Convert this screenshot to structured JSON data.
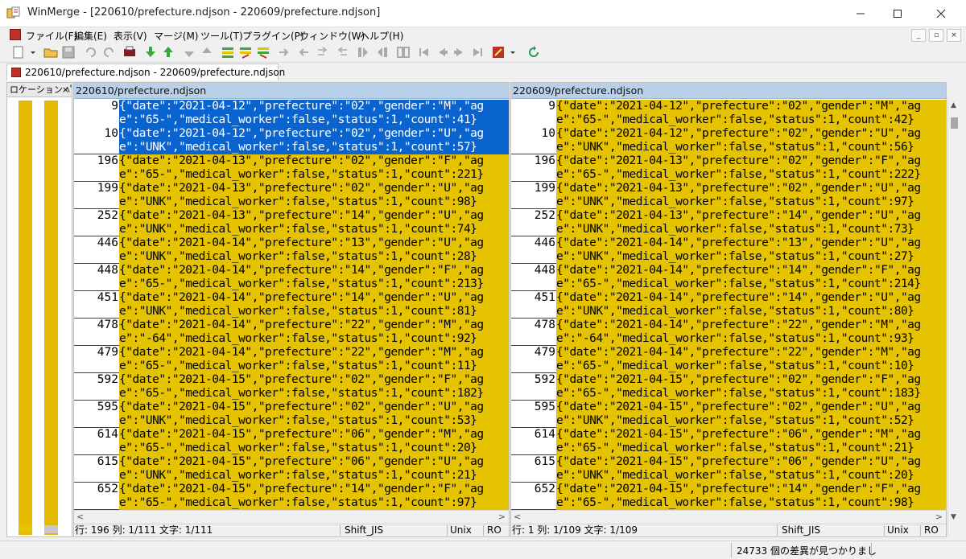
{
  "window": {
    "title": "WinMerge - [220610/prefecture.ndjson - 220609/prefecture.ndjson]"
  },
  "menu": [
    "ファイル(F)",
    "編集(E)",
    "表示(V)",
    "マージ(M)",
    "ツール(T)",
    "プラグイン(P)",
    "ウィンドウ(W)",
    "ヘルプ(H)"
  ],
  "tab": {
    "label": "220610/prefecture.ndjson - 220609/prefecture.ndjson"
  },
  "location_pane": {
    "title": "ロケーション ﾍﾟｲﾝ",
    "close": "×"
  },
  "left": {
    "path": "220610/prefecture.ndjson",
    "rows": [
      {
        "num": "9",
        "a": "{\"date\":\"2021-04-12\",\"prefecture\":\"02\",\"gender\":\"M\",\"ag",
        "b": "e\":\"65-\",\"medical_worker\":false,\"status\":1,\"count\":41}"
      },
      {
        "num": "10",
        "a": "{\"date\":\"2021-04-12\",\"prefecture\":\"02\",\"gender\":\"U\",\"ag",
        "b": "e\":\"UNK\",\"medical_worker\":false,\"status\":1,\"count\":57}"
      },
      {
        "num": "196",
        "a": "{\"date\":\"2021-04-13\",\"prefecture\":\"02\",\"gender\":\"F\",\"ag",
        "b": "e\":\"65-\",\"medical_worker\":false,\"status\":1,\"count\":221}"
      },
      {
        "num": "199",
        "a": "{\"date\":\"2021-04-13\",\"prefecture\":\"02\",\"gender\":\"U\",\"ag",
        "b": "e\":\"UNK\",\"medical_worker\":false,\"status\":1,\"count\":98}"
      },
      {
        "num": "252",
        "a": "{\"date\":\"2021-04-13\",\"prefecture\":\"14\",\"gender\":\"U\",\"ag",
        "b": "e\":\"UNK\",\"medical_worker\":false,\"status\":1,\"count\":74}"
      },
      {
        "num": "446",
        "a": "{\"date\":\"2021-04-14\",\"prefecture\":\"13\",\"gender\":\"U\",\"ag",
        "b": "e\":\"UNK\",\"medical_worker\":false,\"status\":1,\"count\":28}"
      },
      {
        "num": "448",
        "a": "{\"date\":\"2021-04-14\",\"prefecture\":\"14\",\"gender\":\"F\",\"ag",
        "b": "e\":\"65-\",\"medical_worker\":false,\"status\":1,\"count\":213}"
      },
      {
        "num": "451",
        "a": "{\"date\":\"2021-04-14\",\"prefecture\":\"14\",\"gender\":\"U\",\"ag",
        "b": "e\":\"UNK\",\"medical_worker\":false,\"status\":1,\"count\":81}"
      },
      {
        "num": "478",
        "a": "{\"date\":\"2021-04-14\",\"prefecture\":\"22\",\"gender\":\"M\",\"ag",
        "b": "e\":\"-64\",\"medical_worker\":false,\"status\":1,\"count\":92}"
      },
      {
        "num": "479",
        "a": "{\"date\":\"2021-04-14\",\"prefecture\":\"22\",\"gender\":\"M\",\"ag",
        "b": "e\":\"65-\",\"medical_worker\":false,\"status\":1,\"count\":11}"
      },
      {
        "num": "592",
        "a": "{\"date\":\"2021-04-15\",\"prefecture\":\"02\",\"gender\":\"F\",\"ag",
        "b": "e\":\"65-\",\"medical_worker\":false,\"status\":1,\"count\":182}"
      },
      {
        "num": "595",
        "a": "{\"date\":\"2021-04-15\",\"prefecture\":\"02\",\"gender\":\"U\",\"ag",
        "b": "e\":\"UNK\",\"medical_worker\":false,\"status\":1,\"count\":53}"
      },
      {
        "num": "614",
        "a": "{\"date\":\"2021-04-15\",\"prefecture\":\"06\",\"gender\":\"M\",\"ag",
        "b": "e\":\"65-\",\"medical_worker\":false,\"status\":1,\"count\":20}"
      },
      {
        "num": "615",
        "a": "{\"date\":\"2021-04-15\",\"prefecture\":\"06\",\"gender\":\"U\",\"ag",
        "b": "e\":\"UNK\",\"medical_worker\":false,\"status\":1,\"count\":21}"
      },
      {
        "num": "652",
        "a": "{\"date\":\"2021-04-15\",\"prefecture\":\"14\",\"gender\":\"F\",\"ag",
        "b": "e\":\"65-\",\"medical_worker\":false,\"status\":1,\"count\":97}"
      }
    ],
    "status": {
      "pos": "行: 196  列: 1/111  文字: 1/111",
      "encoding": "Shift_JIS",
      "eol": "Unix",
      "ro": "RO"
    }
  },
  "right": {
    "path": "220609/prefecture.ndjson",
    "rows": [
      {
        "num": "9",
        "a": "{\"date\":\"2021-04-12\",\"prefecture\":\"02\",\"gender\":\"M\",\"ag",
        "b": "e\":\"65-\",\"medical_worker\":false,\"status\":1,\"count\":42}"
      },
      {
        "num": "10",
        "a": "{\"date\":\"2021-04-12\",\"prefecture\":\"02\",\"gender\":\"U\",\"ag",
        "b": "e\":\"UNK\",\"medical_worker\":false,\"status\":1,\"count\":56}"
      },
      {
        "num": "196",
        "a": "{\"date\":\"2021-04-13\",\"prefecture\":\"02\",\"gender\":\"F\",\"ag",
        "b": "e\":\"65-\",\"medical_worker\":false,\"status\":1,\"count\":222}"
      },
      {
        "num": "199",
        "a": "{\"date\":\"2021-04-13\",\"prefecture\":\"02\",\"gender\":\"U\",\"ag",
        "b": "e\":\"UNK\",\"medical_worker\":false,\"status\":1,\"count\":97}"
      },
      {
        "num": "252",
        "a": "{\"date\":\"2021-04-13\",\"prefecture\":\"14\",\"gender\":\"U\",\"ag",
        "b": "e\":\"UNK\",\"medical_worker\":false,\"status\":1,\"count\":73}"
      },
      {
        "num": "446",
        "a": "{\"date\":\"2021-04-14\",\"prefecture\":\"13\",\"gender\":\"U\",\"ag",
        "b": "e\":\"UNK\",\"medical_worker\":false,\"status\":1,\"count\":27}"
      },
      {
        "num": "448",
        "a": "{\"date\":\"2021-04-14\",\"prefecture\":\"14\",\"gender\":\"F\",\"ag",
        "b": "e\":\"65-\",\"medical_worker\":false,\"status\":1,\"count\":214}"
      },
      {
        "num": "451",
        "a": "{\"date\":\"2021-04-14\",\"prefecture\":\"14\",\"gender\":\"U\",\"ag",
        "b": "e\":\"UNK\",\"medical_worker\":false,\"status\":1,\"count\":80}"
      },
      {
        "num": "478",
        "a": "{\"date\":\"2021-04-14\",\"prefecture\":\"22\",\"gender\":\"M\",\"ag",
        "b": "e\":\"-64\",\"medical_worker\":false,\"status\":1,\"count\":93}"
      },
      {
        "num": "479",
        "a": "{\"date\":\"2021-04-14\",\"prefecture\":\"22\",\"gender\":\"M\",\"ag",
        "b": "e\":\"65-\",\"medical_worker\":false,\"status\":1,\"count\":10}"
      },
      {
        "num": "592",
        "a": "{\"date\":\"2021-04-15\",\"prefecture\":\"02\",\"gender\":\"F\",\"ag",
        "b": "e\":\"65-\",\"medical_worker\":false,\"status\":1,\"count\":183}"
      },
      {
        "num": "595",
        "a": "{\"date\":\"2021-04-15\",\"prefecture\":\"02\",\"gender\":\"U\",\"ag",
        "b": "e\":\"UNK\",\"medical_worker\":false,\"status\":1,\"count\":52}"
      },
      {
        "num": "614",
        "a": "{\"date\":\"2021-04-15\",\"prefecture\":\"06\",\"gender\":\"M\",\"ag",
        "b": "e\":\"65-\",\"medical_worker\":false,\"status\":1,\"count\":21}"
      },
      {
        "num": "615",
        "a": "{\"date\":\"2021-04-15\",\"prefecture\":\"06\",\"gender\":\"U\",\"ag",
        "b": "e\":\"UNK\",\"medical_worker\":false,\"status\":1,\"count\":20}"
      },
      {
        "num": "652",
        "a": "{\"date\":\"2021-04-15\",\"prefecture\":\"14\",\"gender\":\"F\",\"ag",
        "b": "e\":\"65-\",\"medical_worker\":false,\"status\":1,\"count\":98}"
      }
    ],
    "status": {
      "pos": "行: 1  列: 1/109  文字: 1/109",
      "encoding": "Shift_JIS",
      "eol": "Unix",
      "ro": "RO"
    }
  },
  "bottom_status": {
    "message": "24733 個の差異が見つかりまし"
  },
  "colors": {
    "diff": "#e6c300",
    "selected": "#0a64d0",
    "header": "#b8d0e8"
  }
}
